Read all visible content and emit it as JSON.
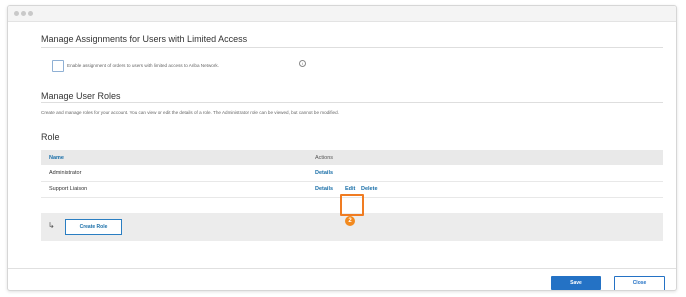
{
  "limited_access": {
    "title": "Manage Assignments for Users with Limited Access",
    "checkbox_label": "Enable assignment of orders to users with limited access to Ariba Network.",
    "checkbox_checked": false,
    "info_icon": "info-icon"
  },
  "user_roles": {
    "title": "Manage User Roles",
    "description": "Create and manage roles for your account. You can view or edit the details of a role. The Administrator role can be viewed, but cannot be modified."
  },
  "roles_table": {
    "heading": "Role",
    "columns": [
      "Name",
      "Actions"
    ],
    "rows": [
      {
        "name": "Administrator",
        "actions": [
          "Details"
        ]
      },
      {
        "name": "Support Liaison",
        "actions": [
          "Details",
          "Edit",
          "Delete"
        ]
      }
    ],
    "create_button": "Create Role",
    "row_arrow_icon": "subdirectory-arrow-icon"
  },
  "annotation": {
    "step_number": "2",
    "highlight_color": "#f07c22"
  },
  "footer": {
    "save_label": "Save",
    "close_label": "Close"
  },
  "colors": {
    "primary_button": "#2472c5",
    "link": "#1a6fa8"
  }
}
